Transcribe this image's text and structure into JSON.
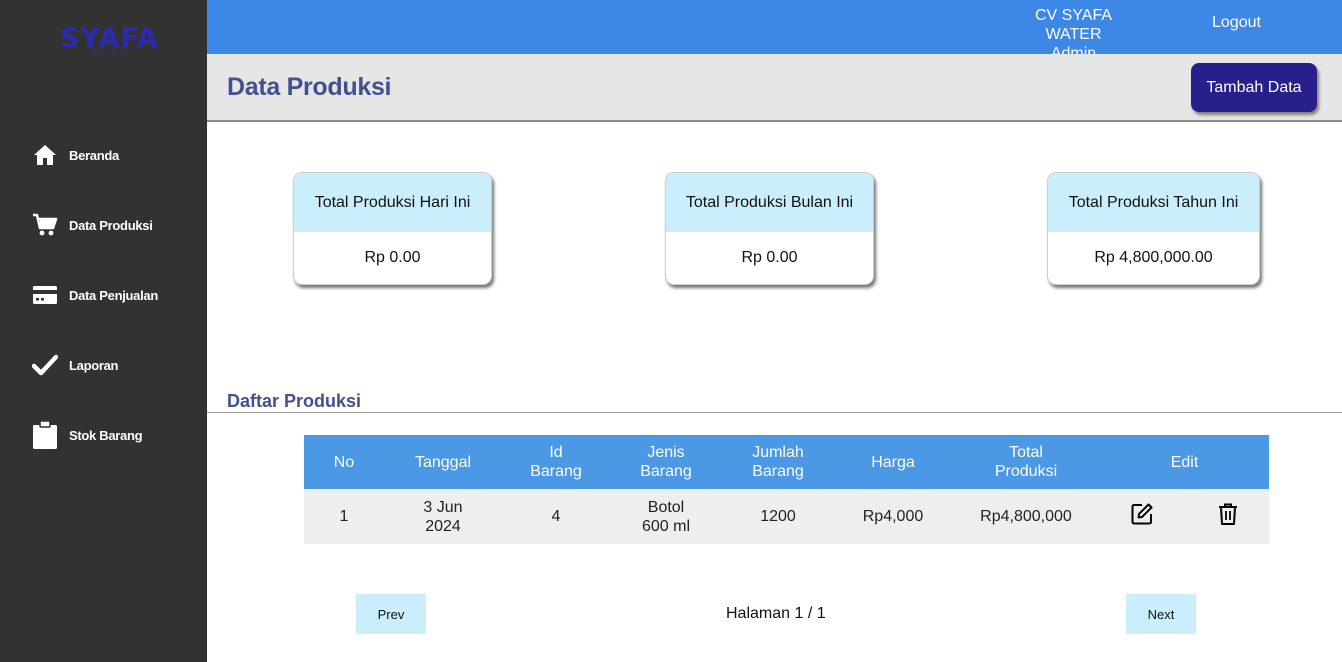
{
  "brand": {
    "logo_text": "SYAFA",
    "logo_sub": "WATER"
  },
  "sidebar": {
    "items": [
      {
        "label": "Beranda",
        "icon": "home-icon"
      },
      {
        "label": "Data Produksi",
        "icon": "cart-icon"
      },
      {
        "label": "Data Penjualan",
        "icon": "credit-card-icon"
      },
      {
        "label": "Laporan",
        "icon": "check-icon"
      },
      {
        "label": "Stok Barang",
        "icon": "clipboard-icon"
      }
    ]
  },
  "topbar": {
    "company": "CV SYAFA WATER",
    "role": "Admin",
    "logout": "Logout"
  },
  "header": {
    "title": "Data Produksi",
    "add_button": "Tambah Data"
  },
  "cards": [
    {
      "title": "Total Produksi Hari Ini",
      "value": "Rp 0.00"
    },
    {
      "title": "Total Produksi Bulan Ini",
      "value": "Rp 0.00"
    },
    {
      "title": "Total Produksi Tahun Ini",
      "value": "Rp 4,800,000.00"
    }
  ],
  "list": {
    "title": "Daftar Produksi",
    "columns": [
      "No",
      "Tanggal",
      "Id Barang",
      "Jenis Barang",
      "Jumlah Barang",
      "Harga",
      "Total Produksi",
      "Edit"
    ],
    "rows": [
      {
        "no": "1",
        "tanggal": "3 Jun 2024",
        "id_barang": "4",
        "jenis_barang": "Botol 600 ml",
        "jumlah_barang": "1200",
        "harga": "Rp4,000",
        "total_produksi": "Rp4,800,000"
      }
    ]
  },
  "pagination": {
    "prev": "Prev",
    "info": "Halaman 1 / 1",
    "next": "Next"
  },
  "colors": {
    "sidebar": "#323232",
    "topbar": "#3d87e6",
    "accent_button": "#27208a",
    "table_header": "#4b98e4",
    "card_head": "#cbeefc",
    "title_text": "#444f8f"
  }
}
